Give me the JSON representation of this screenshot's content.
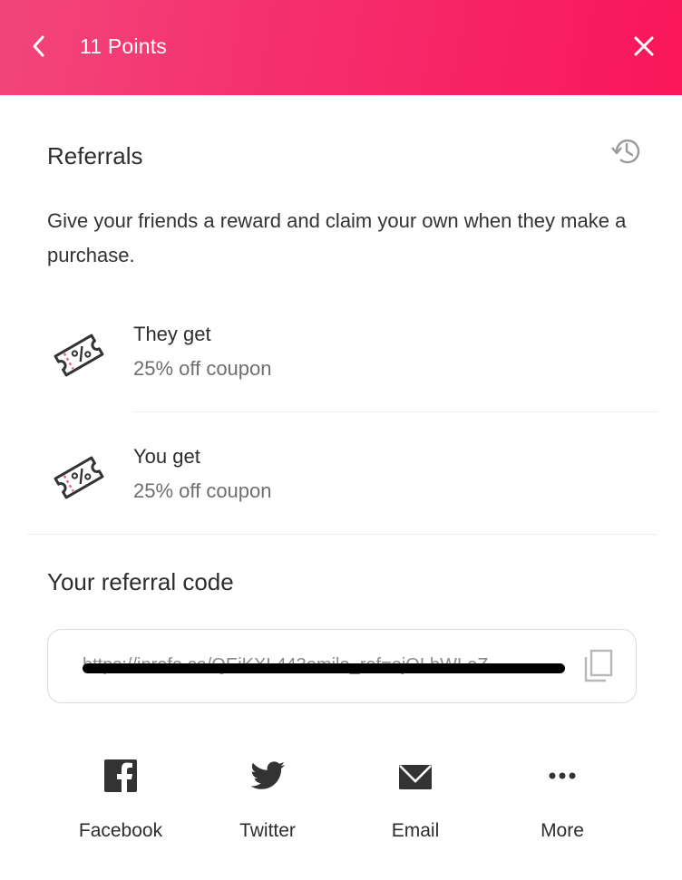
{
  "header": {
    "title": "11 Points",
    "back_icon": "chevron-left-icon",
    "close_icon": "close-icon",
    "gradient_start": "#f2467a",
    "gradient_end": "#f91659"
  },
  "referrals": {
    "title": "Referrals",
    "history_icon": "history-icon",
    "description": "Give your friends a reward and claim your own when they make a purchase.",
    "rewards": [
      {
        "icon": "coupon-percent-icon",
        "label": "They get",
        "value": "25% off coupon"
      },
      {
        "icon": "coupon-percent-icon",
        "label": "You get",
        "value": "25% off coupon"
      }
    ]
  },
  "referral_code": {
    "title": "Your referral code",
    "value": "https://inrefe.co/QEiKXL443emilo_ref=ejOLbWLeZ…",
    "redacted": true,
    "copy_icon": "copy-icon"
  },
  "share": [
    {
      "icon": "facebook-icon",
      "label": "Facebook"
    },
    {
      "icon": "twitter-icon",
      "label": "Twitter"
    },
    {
      "icon": "email-icon",
      "label": "Email"
    },
    {
      "icon": "more-icon",
      "label": "More"
    }
  ],
  "colors": {
    "accent_pink": "#f5306f",
    "icon_dark": "#333333",
    "coupon_dash": "#e5679a",
    "muted_text": "#6f6f6f"
  }
}
